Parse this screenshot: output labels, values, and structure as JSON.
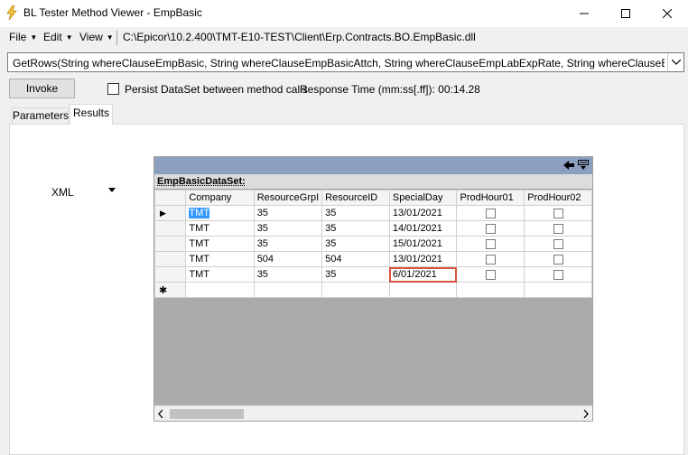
{
  "window": {
    "title": "BL Tester Method Viewer - EmpBasic",
    "app_icon": "lightning-icon",
    "controls": [
      "minimize-icon",
      "maximize-icon",
      "close-icon"
    ]
  },
  "menu": {
    "file": "File",
    "edit": "Edit",
    "view": "View",
    "dll_path": "C:\\Epicor\\10.2.400\\TMT-E10-TEST\\Client\\Erp.Contracts.BO.EmpBasic.dll"
  },
  "method_select": {
    "value": "GetRows(String whereClauseEmpBasic, String whereClauseEmpBasicAttch, String whereClauseEmpLabExpRate, String whereClauseEmpCal, S"
  },
  "toolbar": {
    "invoke_label": "Invoke",
    "persist_label": "Persist DataSet between method calls",
    "persist_checked": false,
    "response_time": "Response Time (mm:ss[.ff]): 00:14.28"
  },
  "tabs": {
    "parameters": "Parameters",
    "results": "Results",
    "active": "Results"
  },
  "output_format": {
    "selected": "XML"
  },
  "grid": {
    "caption_icons": [
      "pin-back-icon",
      "column-chooser-icon"
    ],
    "dataset_name": "EmpBasicDataSet:",
    "columns": [
      "Company",
      "ResourceGrpI",
      "ResourceID",
      "SpecialDay",
      "ProdHour01",
      "ProdHour02"
    ],
    "rows": [
      {
        "company": "TMT",
        "resource_grp": "35",
        "resource_id": "35",
        "special_day": "13/01/2021",
        "prod_hour01": false,
        "prod_hour02": false
      },
      {
        "company": "TMT",
        "resource_grp": "35",
        "resource_id": "35",
        "special_day": "14/01/2021",
        "prod_hour01": false,
        "prod_hour02": false
      },
      {
        "company": "TMT",
        "resource_grp": "35",
        "resource_id": "35",
        "special_day": "15/01/2021",
        "prod_hour01": false,
        "prod_hour02": false
      },
      {
        "company": "TMT",
        "resource_grp": "504",
        "resource_id": "504",
        "special_day": "13/01/2021",
        "prod_hour01": false,
        "prod_hour02": false
      },
      {
        "company": "TMT",
        "resource_grp": "35",
        "resource_id": "35",
        "special_day": "6/01/2021",
        "prod_hour01": false,
        "prod_hour02": false
      }
    ],
    "current_row_marker": "▶",
    "new_row_marker": "✱",
    "highlight_color": "#d9533f",
    "selection_color": "#3399ff",
    "caption_bar_color": "#8d9fbf"
  }
}
